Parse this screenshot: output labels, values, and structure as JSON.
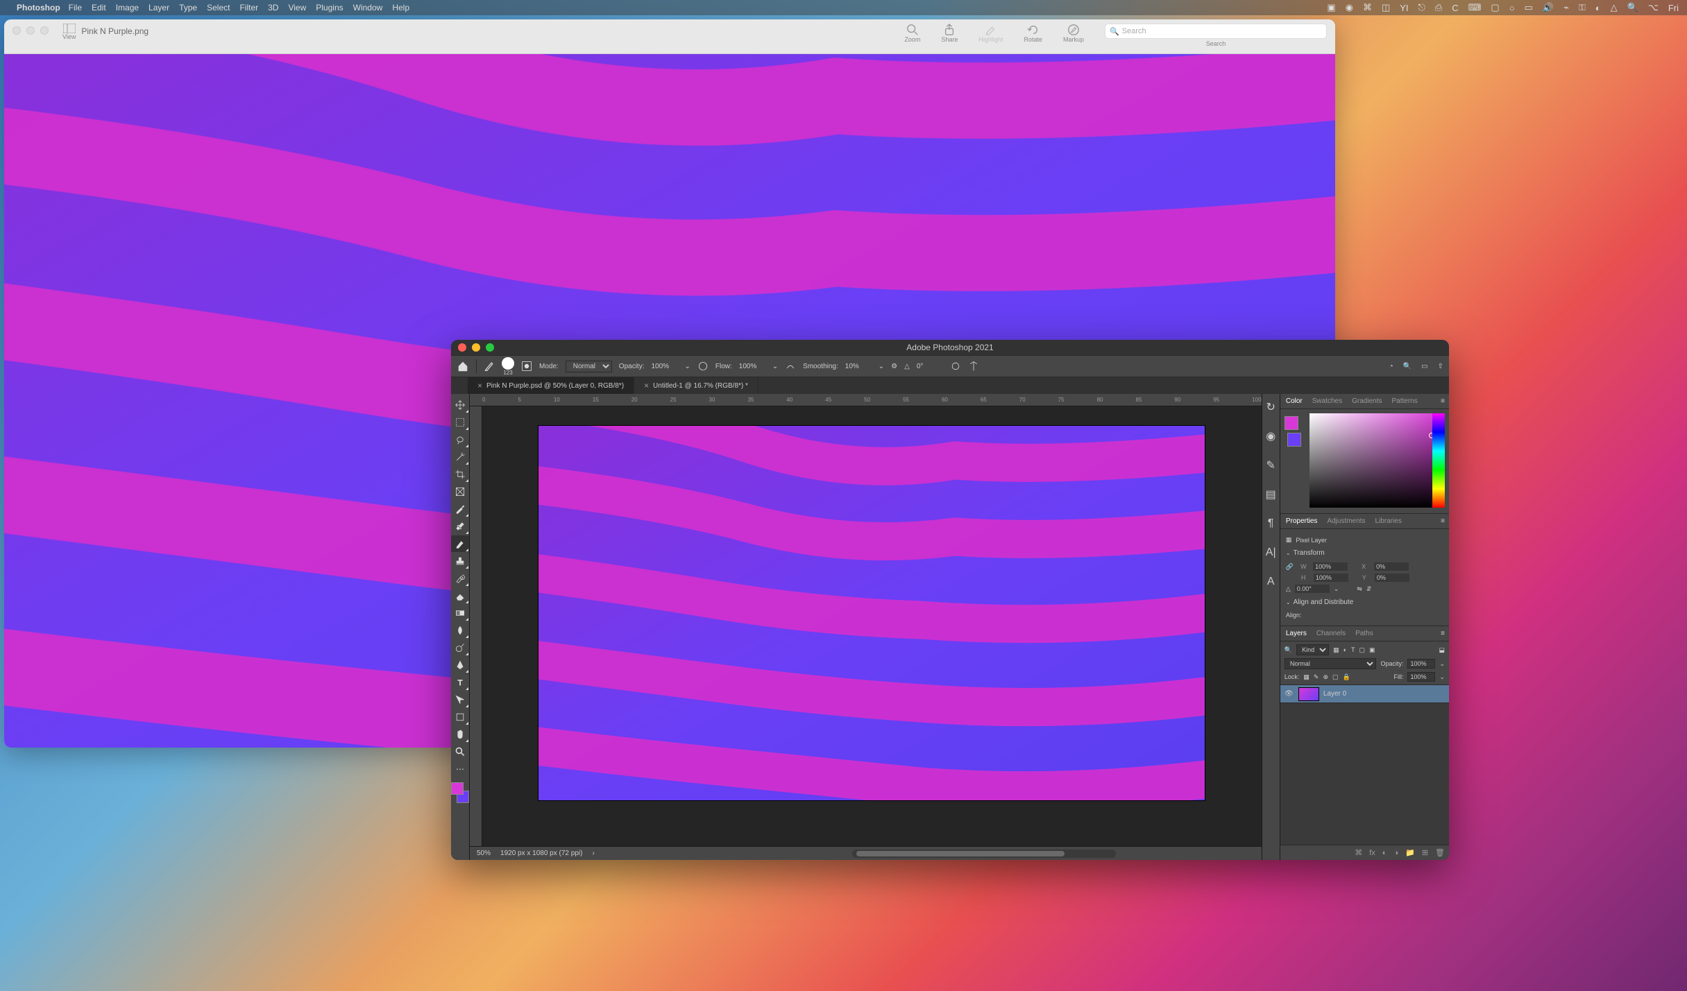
{
  "menubar": {
    "app": "Photoshop",
    "items": [
      "File",
      "Edit",
      "Image",
      "Layer",
      "Type",
      "Select",
      "Filter",
      "3D",
      "View",
      "Plugins",
      "Window",
      "Help"
    ],
    "clock": "Fri"
  },
  "preview": {
    "filename": "Pink N Purple.png",
    "view_label": "View",
    "tools": {
      "zoom": "Zoom",
      "share": "Share",
      "highlight": "Highlight",
      "rotate": "Rotate",
      "markup": "Markup",
      "search": "Search"
    },
    "search_placeholder": "Search"
  },
  "photoshop": {
    "title": "Adobe Photoshop 2021",
    "options": {
      "brush_size": "123",
      "mode_label": "Mode:",
      "mode_value": "Normal",
      "opacity_label": "Opacity:",
      "opacity_value": "100%",
      "flow_label": "Flow:",
      "flow_value": "100%",
      "smoothing_label": "Smoothing:",
      "smoothing_value": "10%",
      "angle_value": "0°"
    },
    "tabs": [
      {
        "label": "Pink N Purple.psd @ 50% (Layer 0, RGB/8*)",
        "active": true
      },
      {
        "label": "Untitled-1 @ 16.7% (RGB/8*) *",
        "active": false
      }
    ],
    "ruler_marks": [
      "0",
      "5",
      "10",
      "15",
      "20",
      "25",
      "30",
      "35",
      "40",
      "45",
      "50",
      "55",
      "60",
      "65",
      "70",
      "75",
      "80",
      "85",
      "90",
      "95",
      "100"
    ],
    "status": {
      "zoom": "50%",
      "docinfo": "1920 px x 1080 px (72 ppi)"
    },
    "panels": {
      "color_tabs": [
        "Color",
        "Swatches",
        "Gradients",
        "Patterns"
      ],
      "prop_tabs": [
        "Properties",
        "Adjustments",
        "Libraries"
      ],
      "layer_tabs": [
        "Layers",
        "Channels",
        "Paths"
      ],
      "pixel_layer": "Pixel Layer",
      "transform": "Transform",
      "W": "W",
      "W_val": "100%",
      "H": "H",
      "H_val": "100%",
      "X": "X",
      "X_val": "0%",
      "Y": "Y",
      "Y_val": "0%",
      "angle_val": "0.00°",
      "align": "Align and Distribute",
      "align_label": "Align:",
      "kind": "Kind",
      "blend_mode": "Normal",
      "layer_opacity_label": "Opacity:",
      "layer_opacity": "100%",
      "lock_label": "Lock:",
      "fill_label": "Fill:",
      "fill_value": "100%",
      "layer0": "Layer 0"
    },
    "colors": {
      "fg": "#d938d9",
      "bg": "#6a3ff5"
    }
  }
}
